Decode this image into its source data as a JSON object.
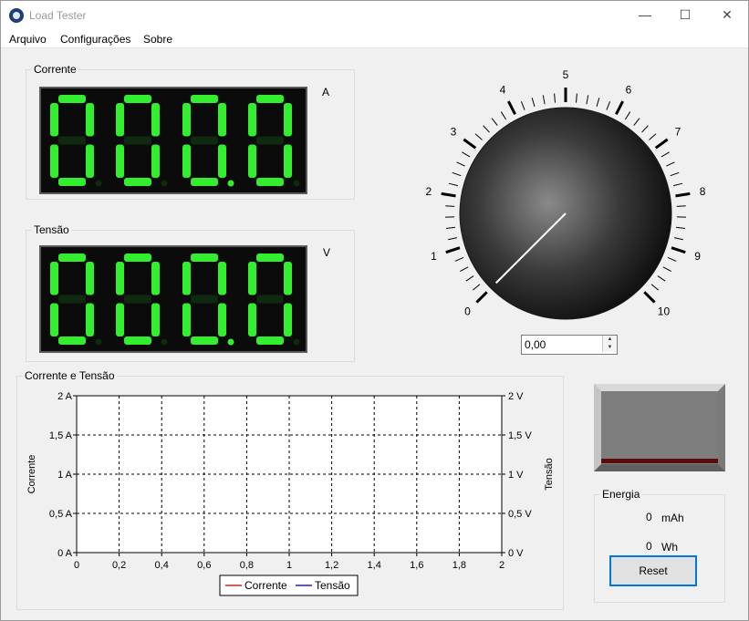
{
  "window": {
    "title": "Load Tester",
    "minimize": "—",
    "maximize": "☐",
    "close": "✕"
  },
  "menu": [
    "Arquivo",
    "Configurações",
    "Sobre"
  ],
  "current": {
    "legend": "Corrente",
    "display": "0.0.0.0",
    "unit": "A"
  },
  "voltage": {
    "legend": "Tensão",
    "display": "0.0.0.0",
    "unit": "V"
  },
  "knob": {
    "scale_labels": [
      "0",
      "1",
      "2",
      "3",
      "4",
      "5",
      "6",
      "7",
      "8",
      "9",
      "10"
    ],
    "value": 0,
    "input_value": "0,00"
  },
  "chart": {
    "legend": "Corrente e Tensão",
    "left_axis_label": "Corrente",
    "right_axis_label": "Tensão",
    "left_ticks": [
      "2 A",
      "1,5 A",
      "1 A",
      "0,5 A",
      "0 A"
    ],
    "right_ticks": [
      "2 V",
      "1,5 V",
      "1 V",
      "0,5 V",
      "0 V"
    ],
    "x_ticks": [
      "0",
      "0,2",
      "0,4",
      "0,6",
      "0,8",
      "1",
      "1,2",
      "1,4",
      "1,6",
      "1,8",
      "2"
    ],
    "series": [
      {
        "name": "Corrente",
        "color": "#e02020"
      },
      {
        "name": "Tensão",
        "color": "#2020c0"
      }
    ]
  },
  "chart_data": {
    "type": "line",
    "title": "Corrente e Tensão",
    "xlabel": "",
    "ylabel": "Corrente",
    "y2label": "Tensão",
    "xlim": [
      0,
      2
    ],
    "ylim": [
      0,
      2
    ],
    "y2lim": [
      0,
      2
    ],
    "grid": true,
    "legend_position": "bottom",
    "series": [
      {
        "name": "Corrente",
        "x": [],
        "values": []
      },
      {
        "name": "Tensão",
        "x": [],
        "values": []
      }
    ]
  },
  "energy": {
    "legend": "Energia",
    "mah_value": "0",
    "mah_unit": "mAh",
    "wh_value": "0",
    "wh_unit": "Wh",
    "reset_label": "Reset"
  }
}
